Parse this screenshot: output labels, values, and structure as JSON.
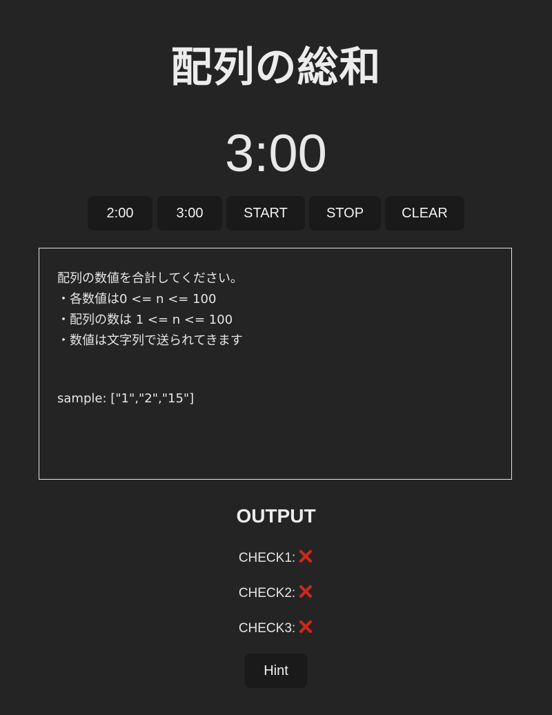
{
  "title": "配列の総和",
  "timer": {
    "display": "3:00"
  },
  "controls": {
    "buttons": [
      "2:00",
      "3:00",
      "START",
      "STOP",
      "CLEAR"
    ]
  },
  "problem": {
    "lines": [
      "配列の数値を合計してください。",
      "・各数値は0 <= n <= 100",
      "・配列の数は 1 <= n <= 100",
      "・数値は文字列で送られてきます"
    ],
    "sample": "sample: [\"1\",\"2\",\"15\"]"
  },
  "output": {
    "title": "OUTPUT",
    "checks": [
      {
        "label": "CHECK1:",
        "status": "fail"
      },
      {
        "label": "CHECK2:",
        "status": "fail"
      },
      {
        "label": "CHECK3:",
        "status": "fail"
      }
    ]
  },
  "hint": {
    "label": "Hint"
  },
  "colors": {
    "background": "#242424",
    "button": "#1a1a1a",
    "fail_mark": "#d0261c"
  },
  "icons": {
    "fail": "cross-icon"
  }
}
